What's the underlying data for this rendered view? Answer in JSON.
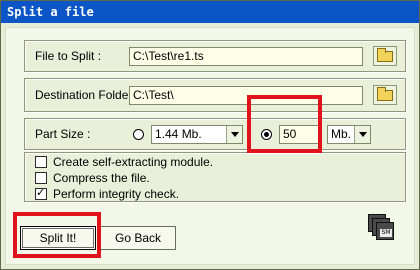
{
  "window": {
    "title": "Split a file"
  },
  "file_to_split": {
    "label": "File to Split :",
    "value": "C:\\Test\\re1.ts",
    "browse_icon": "folder-icon"
  },
  "destination": {
    "label": "Destination Folder :",
    "value": "C:\\Test\\",
    "browse_icon": "folder-icon"
  },
  "part_size": {
    "label": "Part Size :",
    "preset_value": "1.44 Mb.",
    "custom_value": "50",
    "unit_value": "Mb.",
    "selected": "custom"
  },
  "options": [
    {
      "label": "Create self-extracting module.",
      "checked": false
    },
    {
      "label": "Compress the file.",
      "checked": false
    },
    {
      "label": "Perform integrity check.",
      "checked": true
    }
  ],
  "buttons": {
    "split": "Split It!",
    "back": "Go Back"
  },
  "app_icon": {
    "text": "SM",
    "name": "floppy-disks-icon"
  },
  "highlight_color": "#e0121b"
}
